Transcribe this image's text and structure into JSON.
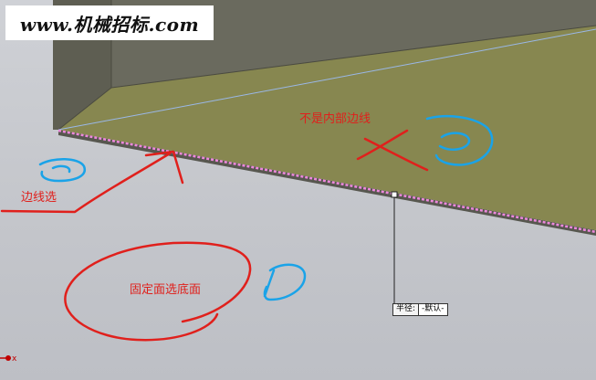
{
  "watermark": {
    "text": "www.机械招标.com"
  },
  "annotations": {
    "not_inner_edge": "不是内部边线",
    "edge_select": "边线选",
    "fixed_face": "固定面选底面"
  },
  "radius_box": {
    "label": "半径:",
    "value": "-默认-"
  },
  "axis": {
    "x_label": "x"
  },
  "colors": {
    "box_top": "#8a8a52",
    "box_front": "#6f6f63",
    "selection_pink": "#ee88dd",
    "ink_red": "#e0201c",
    "ink_blue": "#1aa3e8"
  }
}
